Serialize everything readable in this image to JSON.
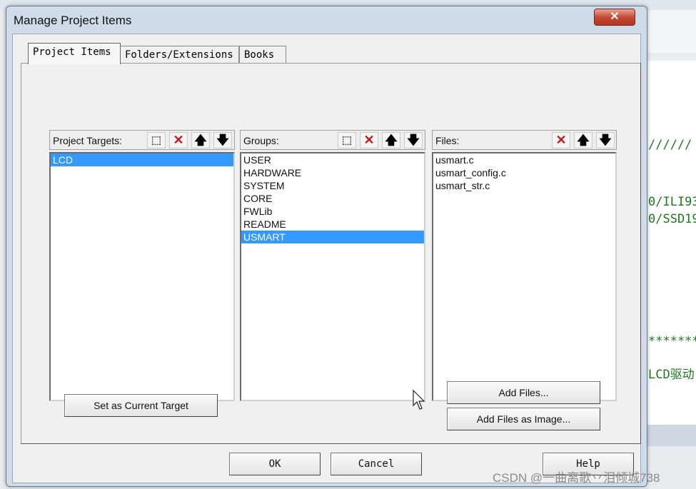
{
  "dialog": {
    "title": "Manage Project Items",
    "close_label": "✕"
  },
  "tabs": [
    {
      "label": "Project Items",
      "active": true
    },
    {
      "label": "Folders/Extensions",
      "active": false
    },
    {
      "label": "Books",
      "active": false
    }
  ],
  "targets": {
    "label": "Project Targets:",
    "items": [
      "LCD"
    ],
    "selected": "LCD",
    "new_icon": "new-item-icon",
    "delete_icon": "delete-icon",
    "up_icon": "move-up-icon",
    "down_icon": "move-down-icon"
  },
  "groups": {
    "label": "Groups:",
    "items": [
      "USER",
      "HARDWARE",
      "SYSTEM",
      "CORE",
      "FWLib",
      "README",
      "USMART"
    ],
    "selected": "USMART"
  },
  "files": {
    "label": "Files:",
    "items": [
      "usmart.c",
      "usmart_config.c",
      "usmart_str.c"
    ]
  },
  "buttons": {
    "set_current_target": "Set as Current Target",
    "add_files": "Add Files...",
    "add_files_as_image": "Add Files as Image...",
    "ok": "OK",
    "cancel": "Cancel",
    "help": "Help"
  },
  "background_editor": {
    "lines": [
      "//////",
      "0/ILI93",
      "0/SSD19",
      "*******",
      "LCD驱动"
    ]
  },
  "watermark": "CSDN @一曲离歌丷泪倾城738",
  "colors": {
    "selection": "#3399ff",
    "delete_icon": "#c41d1d",
    "code_green": "#1f7a1f"
  }
}
